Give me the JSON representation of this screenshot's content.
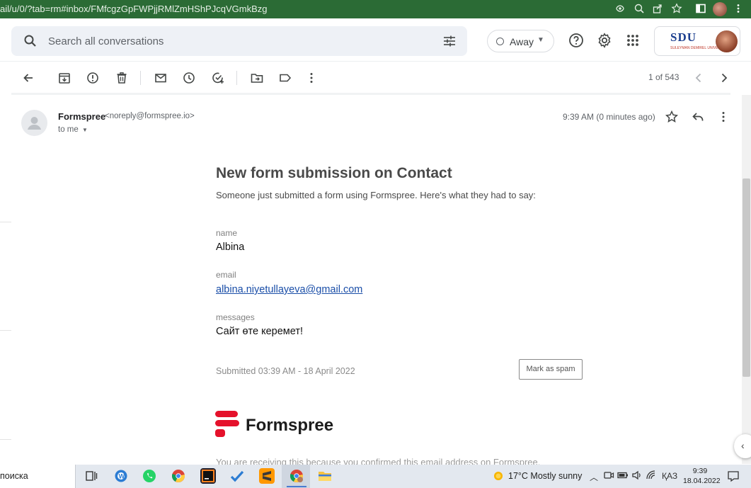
{
  "browser": {
    "url": "ail/u/0/?tab=rm#inbox/FMfcgzGpFWPjjRMlZmHShPJcqVGmkBzg"
  },
  "header": {
    "search_placeholder": "Search all conversations",
    "status_label": "Away",
    "org_logo_text": "SDU",
    "org_logo_subtext": "SULEYMAN DEMIREL UNIVERSITY"
  },
  "toolbar": {
    "page_count": "1 of 543"
  },
  "message": {
    "sender_name": "Formspree",
    "sender_email": "<noreply@formspree.io>",
    "recipient": "to me",
    "time": "9:39 AM (0 minutes ago)"
  },
  "email": {
    "title": "New form submission on Contact",
    "intro": "Someone just submitted a form using Formspree. Here's what they had to say:",
    "fields": [
      {
        "label": "name",
        "value": "Albina"
      },
      {
        "label": "email",
        "value": "albina.niyetullayeva@gmail.com"
      },
      {
        "label": "messages",
        "value": "Сайт өте керемет!"
      }
    ],
    "submitted": "Submitted 03:39 AM - 18 April 2022",
    "spam_button": "Mark as spam",
    "brand_name": "Formspree",
    "footnote": "You are receiving this because you confirmed this email address on Formspree."
  },
  "taskbar": {
    "search_text": "поиска",
    "weather": "17°C  Mostly sunny",
    "language": "ҚАЗ",
    "time": "9:39",
    "date": "18.04.2022"
  },
  "colors": {
    "browser_bar": "#2b6b35",
    "link": "#1a4ea8",
    "formspree_red": "#e5112b"
  }
}
